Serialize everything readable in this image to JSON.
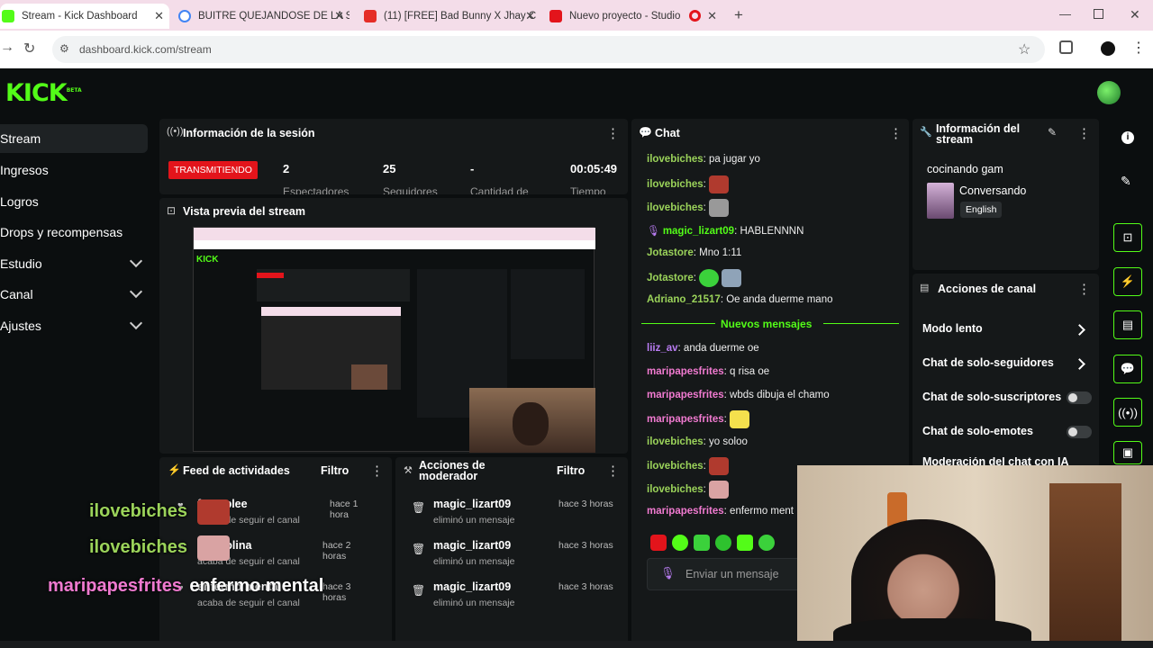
{
  "browser": {
    "tabs": [
      {
        "title": "Stream - Kick Dashboard"
      },
      {
        "title": "BUITRE QUEJANDOSE DE LA SE"
      },
      {
        "title": "(11) [FREE] Bad Bunny X Jhay C"
      },
      {
        "title": "Nuevo proyecto - Studio"
      }
    ],
    "url": "dashboard.kick.com/stream"
  },
  "app": {
    "logo": "KICK",
    "logo_badge": "BETA",
    "sidebar": [
      {
        "label": "Stream"
      },
      {
        "label": "Ingresos"
      },
      {
        "label": "Logros"
      },
      {
        "label": "Drops y recompensas"
      },
      {
        "label": "Estudio"
      },
      {
        "label": "Canal"
      },
      {
        "label": "Ajustes"
      }
    ],
    "session": {
      "title": "Información de la sesión",
      "status": "TRANSMITIENDO",
      "viewers": "2",
      "followers": "25",
      "amount": "-",
      "time": "00:05:49",
      "labels": [
        "Espectadores",
        "Seguidores",
        "Cantidad de",
        "Tiempo"
      ]
    },
    "preview": {
      "title": "Vista previa del stream"
    },
    "feed": {
      "title": "Feed de actividades",
      "filter": "Filtro",
      "items": [
        {
          "name": "fernaplee",
          "sub": "acaba de seguir el canal",
          "time": "hace 1 hora"
        },
        {
          "name": "Alcarolina",
          "sub": "acaba de seguir el canal",
          "time": "hace 2 horas"
        },
        {
          "name": "enfermo mental",
          "sub": "acaba de seguir el canal",
          "time": "hace 3 horas"
        }
      ]
    },
    "moderator": {
      "title_line1": "Acciones de",
      "title_line2": "moderador",
      "filter": "Filtro",
      "items": [
        {
          "name": "magic_lizart09",
          "sub": "eliminó un mensaje",
          "time": "hace 3 horas"
        },
        {
          "name": "magic_lizart09",
          "sub": "eliminó un mensaje",
          "time": "hace 3 horas"
        },
        {
          "name": "magic_lizart09",
          "sub": "eliminó un mensaje",
          "time": "hace 3 horas"
        }
      ]
    },
    "chat": {
      "title": "Chat",
      "messages": [
        {
          "user": "ilovebiches",
          "text": "pa jugar yo"
        },
        {
          "user": "ilovebiches",
          "text": ""
        },
        {
          "user": "ilovebiches",
          "text": ""
        },
        {
          "user": "magic_lizart09",
          "text": "HABLENNNN"
        },
        {
          "user": "Jotastore",
          "text": "Mno 1:11"
        },
        {
          "user": "Jotastore",
          "text": ""
        },
        {
          "user": "Adriano_21517",
          "text": "Oe anda duerme mano"
        },
        {
          "user": "liiz_av",
          "text": "anda duerme oe"
        },
        {
          "user": "maripapesfrites",
          "text": "q risa oe"
        },
        {
          "user": "maripapesfrites",
          "text": "wbds dibuja el chamo"
        },
        {
          "user": "maripapesfrites",
          "text": ""
        },
        {
          "user": "ilovebiches",
          "text": "yo soloo"
        },
        {
          "user": "ilovebiches",
          "text": ""
        },
        {
          "user": "ilovebiches",
          "text": ""
        },
        {
          "user": "maripapesfrites",
          "text": "enfermo ment"
        }
      ],
      "new_messages": "Nuevos mensajes",
      "input_placeholder": "Enviar un mensaje"
    },
    "stream_info": {
      "title_line1": "Información del",
      "title_line2": "stream",
      "stream_title": "cocinando gam",
      "category": "Conversando",
      "language": "English"
    },
    "channel_actions": {
      "title": "Acciones de canal",
      "items": [
        {
          "label": "Modo lento"
        },
        {
          "label": "Chat de solo-seguidores"
        },
        {
          "label": "Chat de solo-suscriptores"
        },
        {
          "label": "Chat de solo-emotes"
        },
        {
          "label": "Moderación del chat con IA"
        }
      ]
    },
    "overlay": {
      "line1": "ilovebiches",
      "line2": "ilovebiches",
      "line3_user": "maripapesfrites",
      "line3_text": "enfermo mental"
    }
  },
  "colors": {
    "accent": "#53fc18",
    "live_red": "#e3141b",
    "panel_bg": "#151819"
  }
}
